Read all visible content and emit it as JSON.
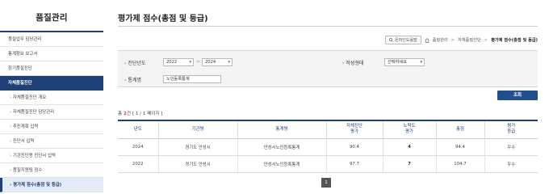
{
  "sidebar": {
    "title": "품질관리",
    "items": [
      {
        "label": "품질업무 담당관리"
      },
      {
        "label": "통계청보 보고서"
      },
      {
        "label": "정기품질진단"
      },
      {
        "label": "자체품질진단"
      },
      {
        "label": "자체품질진단 개요"
      },
      {
        "label": "자체품질진단 담당관리"
      },
      {
        "label": "추진계획 입력"
      },
      {
        "label": "진단서 입력"
      },
      {
        "label": "기관진단용 진단서 입력"
      },
      {
        "label": "품질지원팀 점수"
      },
      {
        "label": "평가제 점수(총점 및 등급)"
      }
    ]
  },
  "header": {
    "title": "평가제 점수(총점 및 등급)"
  },
  "breadcrumb": {
    "manual_label": "온라인도움말",
    "items": [
      "품질관리",
      "자체품질진단",
      "평가제 점수(총점 및 등급)"
    ]
  },
  "search": {
    "year_label": "진단년도",
    "year_from": "2022",
    "year_to": "2024",
    "tilde": "~",
    "status_label": "작성형태",
    "status_value": "선택하세요",
    "stat_label": "통계명",
    "stat_value": "노인등록통계",
    "button_label": "조회"
  },
  "result": {
    "count_prefix": "총",
    "count": "2",
    "count_suffix": "건 [ 1 / 1 페이지 ]"
  },
  "table": {
    "headers": [
      {
        "l1": "년도",
        "l2": ""
      },
      {
        "l1": "기관명",
        "l2": ""
      },
      {
        "l1": "통계명",
        "l2": ""
      },
      {
        "l1": "자체진단",
        "l2": "평가"
      },
      {
        "l1": "노력도",
        "l2": "평가"
      },
      {
        "l1": "총점",
        "l2": ""
      },
      {
        "l1": "평가",
        "l2": "등급"
      }
    ],
    "rows": [
      [
        "2024",
        "경기도 안성시",
        "안성시노인등록통계",
        "90.4",
        "4",
        "94.4",
        "우수"
      ],
      [
        "2022",
        "경기도 안성시",
        "안성시노인등록통계",
        "97.7",
        "7",
        "104.7",
        "우수"
      ]
    ]
  },
  "pagination": {
    "current": "1"
  },
  "colors": {
    "primary": "#1f3f77",
    "accent": "#d04a2a",
    "button": "#1f4f8f"
  }
}
